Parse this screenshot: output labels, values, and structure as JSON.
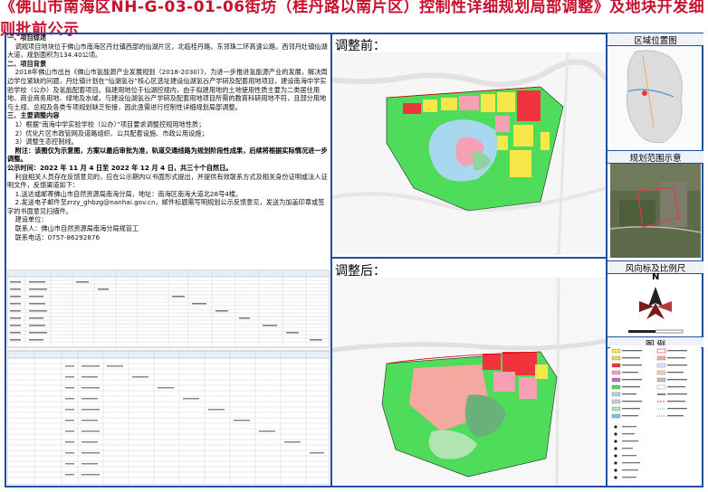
{
  "title": "《佛山市南海区NH-G-03-01-06街坊（桂丹路以南片区）控制性详细规划局部调整》及地块开发细则批前公示",
  "text": {
    "s1_heading": "一、项目综述",
    "s1_body": "调规项目地块位于佛山市南海区丹灶镇西部的仙湖片区，北临桂丹路，东邻珠二环高速公路，西邻丹灶镇仙湖大道，规划面积为134.40公顷。",
    "s2_heading": "二、项目背景",
    "s2_body": "2018年佛山市出台《佛山市氢能源产业发展规划（2018-2030）》，为进一步推进氢能源产业的发展，解决周边学位紧缺的问题，丹灶镇计划在“仙湖氢谷”核心区选址建设仙湖氢谷产学研及配套用地项目，建设南海中学实验学校（公办）及氢能配套项目。拟建用地位于仙湖控规内，由于拟建用地的土地使用性质主要为二类居住用地、商业商务用地、绿地及水域，与建设仙湖氢谷产学研及配套用地项目所需的教育科研用地不符，且部分用地与土规、总规及各类专项规划缺乏衔接，因此亟需进行控制性详细规划局部调整。",
    "s3_heading": "三、主要调整内容",
    "s3_item1": "1）根据“南海中学实验学校（公办）”项目要求调整控规用地性质；",
    "s3_item2": "2）优化片区市政管网及道路组织、公共配套设施、市政公用设施；",
    "s3_item3": "3）调整生态控制线。",
    "s3_note": "附注：该图仅为示意图，方案以最后审批为准，轨道交通线路为规划阶段性成果，后续将根据实际情况进一步调整。",
    "period": "公示时间：2022 年 11 月 4 日至 2022 年 12 月 4 日，共三十个自然日。",
    "feedback": "利益相关人员存在反馈意见的，应在公示期内以书面形式提出，并提供有效联系方式及相关身份证明或法人证明文件，反馈渠道如下：",
    "channel1": "1.送达或邮寄佛山市自然资源局南海分局，地址：南海区南海大道北28号4楼。",
    "channel2": "2.发送电子邮件至zrzy_ghbzg@nanhai.gov.cn，邮件标题需写明规划公示反馈意见，发送为加盖印章或签字的书面意见扫描件。",
    "unit_label": "建设单位：",
    "contact": "联系人：佛山市自然资源局南海分局规管工",
    "phone": "联系电话：0757-86292876"
  },
  "panels": {
    "before": "调整前：",
    "after": "调整后："
  },
  "side": {
    "location": "区域位置图",
    "scope": "规划范围示意",
    "north": "风向标及比例尺",
    "legend": "图 例"
  },
  "north_letter": "N",
  "colors": {
    "frame": "#1e4fa0",
    "title": "#c8102e",
    "green": "#4fdc5a",
    "residential": "#f6e84a",
    "commercial": "#f0333c",
    "education": "#f6a0b4",
    "water": "#a8d8f0",
    "park": "#b0e4b0"
  }
}
